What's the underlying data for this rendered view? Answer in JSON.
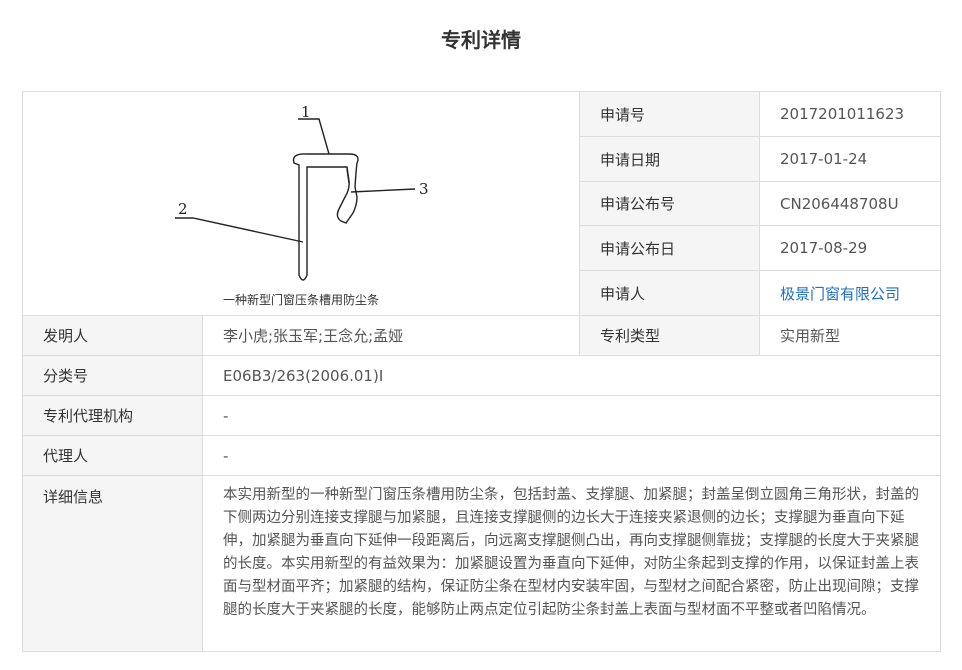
{
  "page": {
    "title": "专利详情"
  },
  "figure": {
    "caption": "一种新型门窗压条槽用防尘条",
    "labels": [
      "1",
      "2",
      "3"
    ]
  },
  "fields": {
    "app_no": {
      "label": "申请号",
      "value": "2017201011623"
    },
    "app_date": {
      "label": "申请日期",
      "value": "2017-01-24"
    },
    "pub_no": {
      "label": "申请公布号",
      "value": "CN206448708U"
    },
    "pub_date": {
      "label": "申请公布日",
      "value": "2017-08-29"
    },
    "applicant": {
      "label": "申请人",
      "value": "极景门窗有限公司"
    },
    "inventor": {
      "label": "发明人",
      "value": "李小虎;张玉军;王念允;孟娅"
    },
    "patent_type": {
      "label": "专利类型",
      "value": "实用新型"
    },
    "classification": {
      "label": "分类号",
      "value": "E06B3/263(2006.01)I"
    },
    "agency": {
      "label": "专利代理机构",
      "value": "-"
    },
    "agent": {
      "label": "代理人",
      "value": "-"
    },
    "details": {
      "label": "详细信息",
      "value": "本实用新型的一种新型门窗压条槽用防尘条，包括封盖、支撑腿、加紧腿；封盖呈倒立圆角三角形状，封盖的下侧两边分别连接支撑腿与加紧腿，且连接支撑腿侧的边长大于连接夹紧退侧的边长；支撑腿为垂直向下延伸，加紧腿为垂直向下延伸一段距离后，向远离支撑腿侧凸出，再向支撑腿侧靠拢；支撑腿的长度大于夹紧腿的长度。本实用新型的有益效果为：加紧腿设置为垂直向下延伸，对防尘条起到支撑的作用，以保证封盖上表面与型材面平齐；加紧腿的结构，保证防尘条在型材内安装牢固，与型材之间配合紧密，防止出现间隙；支撑腿的长度大于夹紧腿的长度，能够防止两点定位引起防尘条封盖上表面与型材面不平整或者凹陷情况。"
    }
  },
  "colors": {
    "link": "#1f6fc5",
    "label_bg": "#f5f5f5",
    "border": "#dcdcdc"
  }
}
